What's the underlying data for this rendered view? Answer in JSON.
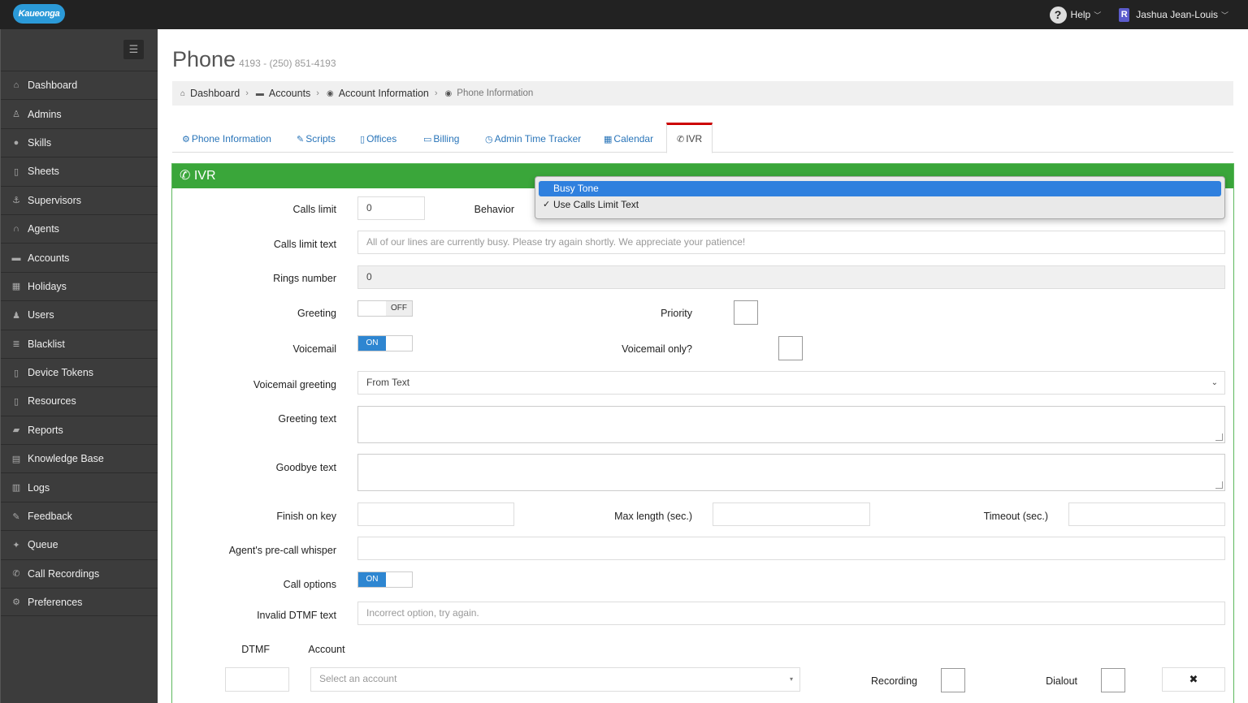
{
  "topbar": {
    "logo_text": "Kaueonga",
    "help_label": "Help",
    "user_name": "Jashua Jean-Louis",
    "user_initial": "R"
  },
  "sidebar": {
    "items": [
      {
        "label": "Dashboard",
        "icon": "home-icon"
      },
      {
        "label": "Admins",
        "icon": "male-icon"
      },
      {
        "label": "Skills",
        "icon": "globe-icon"
      },
      {
        "label": "Sheets",
        "icon": "file-icon"
      },
      {
        "label": "Supervisors",
        "icon": "anchor-icon"
      },
      {
        "label": "Agents",
        "icon": "headphones-icon"
      },
      {
        "label": "Accounts",
        "icon": "briefcase-icon"
      },
      {
        "label": "Holidays",
        "icon": "calendar-icon"
      },
      {
        "label": "Users",
        "icon": "users-icon"
      },
      {
        "label": "Blacklist",
        "icon": "list-icon"
      },
      {
        "label": "Device Tokens",
        "icon": "mobile-icon"
      },
      {
        "label": "Resources",
        "icon": "mobile-icon"
      },
      {
        "label": "Reports",
        "icon": "book-icon"
      },
      {
        "label": "Knowledge Base",
        "icon": "archive-icon"
      },
      {
        "label": "Logs",
        "icon": "bar-chart-icon"
      },
      {
        "label": "Feedback",
        "icon": "pencil-icon"
      },
      {
        "label": "Queue",
        "icon": "wrench-icon"
      },
      {
        "label": "Call Recordings",
        "icon": "phone-icon"
      },
      {
        "label": "Preferences",
        "icon": "gear-icon"
      }
    ]
  },
  "page": {
    "title": "Phone",
    "subtitle": "4193 - (250) 851-4193"
  },
  "breadcrumb": {
    "items": [
      "Dashboard",
      "Accounts",
      "Account Information"
    ],
    "current": "Phone Information"
  },
  "tabs": [
    {
      "label": "Phone Information",
      "icon": "gear-icon"
    },
    {
      "label": "Scripts",
      "icon": "edit-icon"
    },
    {
      "label": "Offices",
      "icon": "file-icon"
    },
    {
      "label": "Billing",
      "icon": "credit-card-icon"
    },
    {
      "label": "Admin Time Tracker",
      "icon": "clock-icon"
    },
    {
      "label": "Calendar",
      "icon": "calendar-icon"
    },
    {
      "label": "IVR",
      "icon": "phone-icon",
      "active": true
    }
  ],
  "panel": {
    "title": "IVR"
  },
  "form": {
    "calls_limit_label": "Calls limit",
    "calls_limit_value": "0",
    "behavior_label": "Behavior",
    "calls_limit_text_label": "Calls limit text",
    "calls_limit_text_value": "All of our lines are currently busy. Please try again shortly. We appreciate your patience!",
    "rings_number_label": "Rings number",
    "rings_number_value": "0",
    "greeting_label": "Greeting",
    "greeting_toggle": "OFF",
    "priority_label": "Priority",
    "voicemail_label": "Voicemail",
    "voicemail_toggle": "ON",
    "voicemail_only_label": "Voicemail only?",
    "voicemail_greeting_label": "Voicemail greeting",
    "voicemail_greeting_value": "From Text",
    "greeting_text_label": "Greeting text",
    "goodbye_text_label": "Goodbye text",
    "finish_on_key_label": "Finish on key",
    "max_length_label": "Max length (sec.)",
    "timeout_label": "Timeout (sec.)",
    "precall_whisper_label": "Agent's pre-call whisper",
    "call_options_label": "Call options",
    "call_options_toggle": "ON",
    "invalid_dtmf_label": "Invalid DTMF text",
    "invalid_dtmf_placeholder": "Incorrect option, try again.",
    "dtmf_header": "DTMF",
    "account_header": "Account",
    "account_placeholder": "Select an account",
    "recording_label": "Recording",
    "dialout_label": "Dialout",
    "remove_label": "✖"
  },
  "behavior_dropdown": {
    "options": [
      "Busy Tone",
      "Use Calls Limit Text"
    ],
    "highlighted": "Busy Tone",
    "selected": "Use Calls Limit Text",
    "check_mark": "✓"
  },
  "colors": {
    "topbar": "#222222",
    "sidebar": "#3c3c3c",
    "panel_header": "#3aa63a",
    "link": "#2a75b9",
    "toggle_on": "#2e86d1",
    "active_tab_border": "#cc0000"
  }
}
